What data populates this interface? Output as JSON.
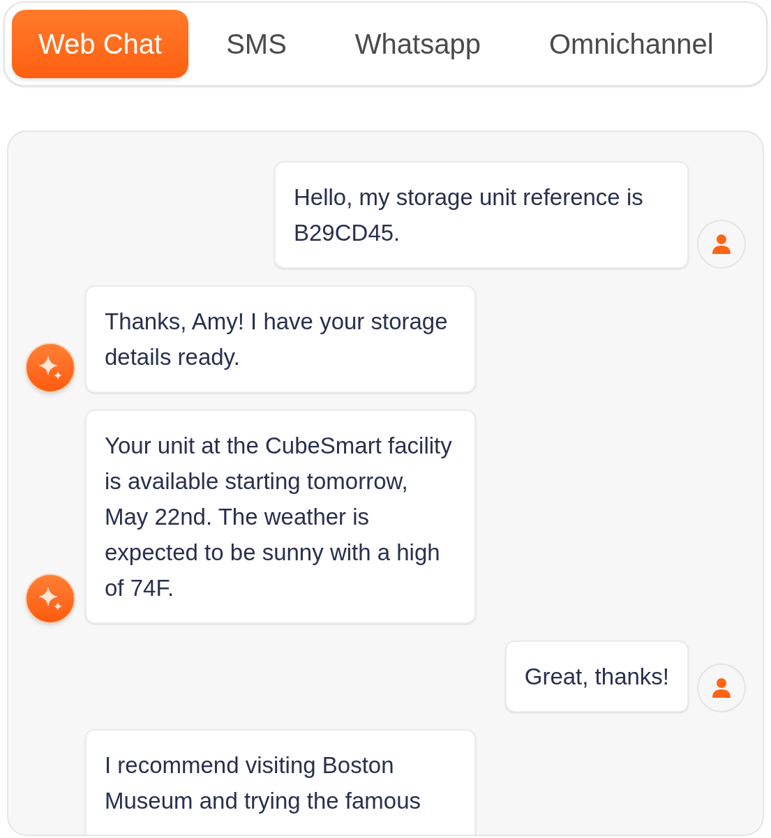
{
  "tabs": [
    {
      "label": "Web Chat",
      "selected": true
    },
    {
      "label": "SMS",
      "selected": false
    },
    {
      "label": "Whatsapp",
      "selected": false
    },
    {
      "label": "Omnichannel",
      "selected": false
    }
  ],
  "messages": [
    {
      "kind": "user",
      "text": "Hello, my storage unit reference is B29CD45.",
      "avatar": true
    },
    {
      "kind": "bot",
      "text": "Thanks, Amy! I have your storage details ready.",
      "avatar": true
    },
    {
      "kind": "bot",
      "text": "Your unit at the CubeSmart facility is available starting tomorrow, May 22nd. The weather is expected to be sunny with a high of 74F.",
      "avatar": true
    },
    {
      "kind": "user",
      "text": "Great, thanks!",
      "avatar": true
    },
    {
      "kind": "bot",
      "text": "I recommend visiting Boston Museum and trying the famous",
      "avatar": false
    }
  ]
}
